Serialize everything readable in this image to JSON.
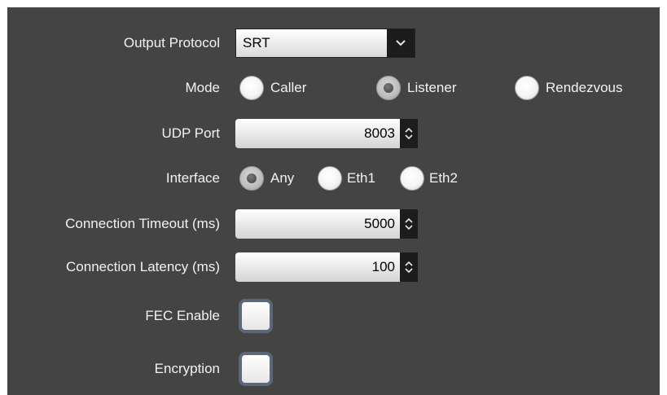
{
  "output_protocol": {
    "label": "Output Protocol",
    "selected": "SRT",
    "icon": "chevron-down-icon"
  },
  "mode": {
    "label": "Mode",
    "options": [
      {
        "label": "Caller",
        "selected": false
      },
      {
        "label": "Listener",
        "selected": true
      },
      {
        "label": "Rendezvous",
        "selected": false
      }
    ]
  },
  "udp_port": {
    "label": "UDP Port",
    "value": "8003"
  },
  "interface": {
    "label": "Interface",
    "options": [
      {
        "label": "Any",
        "selected": true
      },
      {
        "label": "Eth1",
        "selected": false
      },
      {
        "label": "Eth2",
        "selected": false
      }
    ]
  },
  "connection_timeout": {
    "label": "Connection Timeout (ms)",
    "value": "5000"
  },
  "connection_latency": {
    "label": "Connection Latency (ms)",
    "value": "100"
  },
  "fec_enable": {
    "label": "FEC Enable",
    "checked": false
  },
  "encryption": {
    "label": "Encryption",
    "checked": false
  },
  "colors": {
    "panel_background": "#444444",
    "label_text": "#f2f2f2",
    "checkbox_border": "#5b6878"
  }
}
